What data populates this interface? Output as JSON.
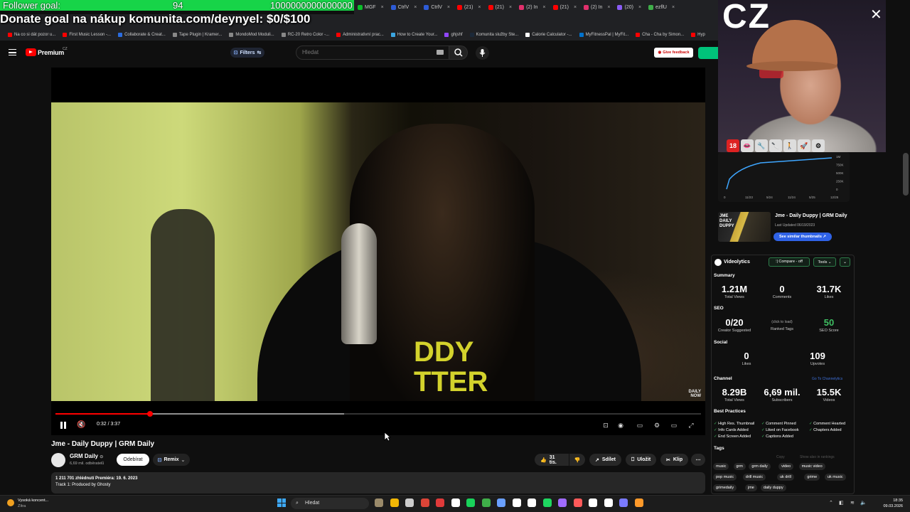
{
  "overlay": {
    "follower_label": "Follower goal:",
    "follower_count": "94",
    "follower_goal": "1000000000000000",
    "donate_text": "Donate goal na nákup komunita.com/deynyel: $0/$100",
    "cz_text": "CZ",
    "emotes": [
      "18",
      "👄",
      "🔧",
      "🔪",
      "🚶",
      "🚀",
      "⚙"
    ]
  },
  "browser": {
    "tabs": [
      {
        "label": "MGF",
        "color": "#0bbd2a"
      },
      {
        "label": "CtrlV",
        "color": "#2d5bd6"
      },
      {
        "label": "CtrlV",
        "color": "#2d5bd6"
      },
      {
        "label": "(21)",
        "color": "#ff0000"
      },
      {
        "label": "(21)",
        "color": "#ff0000"
      },
      {
        "label": "(2) In",
        "color": "#e1306c"
      },
      {
        "label": "(21)",
        "color": "#ff0000"
      },
      {
        "label": "(2) In",
        "color": "#e1306c"
      },
      {
        "label": "(20)",
        "color": "#8a5cf6"
      },
      {
        "label": "ezflU",
        "color": "#3fae49"
      }
    ],
    "bookmarks": [
      {
        "label": "Na co si dát pozor u...",
        "color": "#ff0000"
      },
      {
        "label": "First Music Lesson -...",
        "color": "#ff0000"
      },
      {
        "label": "Collaborate & Creat...",
        "color": "#2b6cdf"
      },
      {
        "label": "Tape Plugin | Kramer...",
        "color": "#888888"
      },
      {
        "label": "MondoMod Moduli...",
        "color": "#888888"
      },
      {
        "label": "RC-20 Retro Color -...",
        "color": "#888888"
      },
      {
        "label": "Administrativní prac...",
        "color": "#ff0000"
      },
      {
        "label": "How to Create Your...",
        "color": "#3ba5e0"
      },
      {
        "label": "ghjshf",
        "color": "#9146ff"
      },
      {
        "label": "Komunita služby Ste...",
        "color": "#1b2838"
      },
      {
        "label": "Calorie Calculator -...",
        "color": "#ffffff"
      },
      {
        "label": "MyFitnessPal | MyFit...",
        "color": "#0072ce"
      },
      {
        "label": "Cha - Cha by Simon...",
        "color": "#ff0000"
      },
      {
        "label": "Hyp",
        "color": "#ff0000"
      }
    ]
  },
  "youtube": {
    "brand": "Premium",
    "region": "CZ",
    "filters_label": "Filters",
    "search_placeholder": "Hledat",
    "feedback_label": "Give feedback"
  },
  "player": {
    "time": "0:32 / 3:37",
    "progress": 0.147,
    "buffered": 0.447,
    "shirt_text": "DDY\nTTER",
    "now_logo": "DAILY\nNOW"
  },
  "video": {
    "title": "Jme - Daily Duppy | GRM Daily",
    "channel": "GRM Daily",
    "channel_check": "⊙",
    "subscribers": "6,69 mil. odběratelů",
    "subscribe_label": "Odebírat",
    "remix_label": "Remix",
    "likes_label": "31 tis.",
    "share_label": "Sdílet",
    "save_label": "Uložit",
    "clip_label": "Klip",
    "views_line": "1 211 701 zhlédnutí  Premiéra: 19. 6. 2023",
    "desc_line": "Track 1: Produced by Ghosty"
  },
  "sidepanel": {
    "graph_ylabels": [
      "1M",
      "750K",
      "500K",
      "250K",
      "0"
    ],
    "graph_xlabels": [
      "0",
      "11/23",
      "5/24",
      "11/24",
      "5/25",
      "12/25"
    ],
    "thumb_title": "Jme - Daily Duppy | GRM Daily",
    "thumb_updated": "Last Updated 06/19/2023",
    "thumb_label": "JME\nDAILY\nDUPPY",
    "similar_label": "See similar thumbnails ↗",
    "vl_title": "Videolytics",
    "compare_label": "⫶| Compare - off",
    "tools_label": "Tools ⌄",
    "dd_label": "⌄",
    "summary_label": "Summary",
    "summary": [
      {
        "value": "1.21M",
        "label": "Total Views"
      },
      {
        "value": "0",
        "label": "Comments"
      },
      {
        "value": "31.7K",
        "label": "Likes"
      }
    ],
    "seo_label": "SEO",
    "seo": [
      {
        "value": "0/20",
        "label": "Creator Suggested"
      },
      {
        "value": "(click to load)",
        "label": "Ranked Tags"
      },
      {
        "value": "50",
        "label": "SEO Score"
      }
    ],
    "social_label": "Social",
    "social": [
      {
        "value": "0",
        "label": "Likes"
      },
      {
        "value": "109",
        "label": "Upvotes"
      }
    ],
    "channel_label": "Channel",
    "go_label": "Go To Channelytics",
    "channel": [
      {
        "value": "8.29B",
        "label": "Total Views"
      },
      {
        "value": "6,69 mil.",
        "label": "Subscribers"
      },
      {
        "value": "15.5K",
        "label": "Videos"
      }
    ],
    "bp_label": "Best Practices",
    "best_practices": [
      [
        "High Res. Thumbnail",
        "Comment Pinned",
        "Comment Hearted"
      ],
      [
        "Info Cards Added",
        "Liked on Facebook",
        "Chapters Added"
      ],
      [
        "End Screen Added",
        "Captions Added",
        ""
      ]
    ],
    "tags_label": "Tags",
    "tags_copy": "Copy",
    "tags_show": "Show also in rankings",
    "tags": [
      "music",
      "grm",
      "grm daily",
      "video",
      "music video",
      "pop music",
      "drill music",
      "uk drill",
      "grime",
      "uk music",
      "grimedaily",
      "jme",
      "daily duppy"
    ]
  },
  "taskbar": {
    "weather_line1": "Vysoká koncent...",
    "weather_line2": "Zítra",
    "search_label": "Hledat",
    "time": "18:35",
    "date": "09.03.2026",
    "apps": [
      "#9a8a6a",
      "#f2b705",
      "#cccccc",
      "#db4437",
      "#e03a3a",
      "#ffffff",
      "#19d25a",
      "#3fae49",
      "#6aa0ff",
      "#ffffff",
      "#ffffff",
      "#1ed760",
      "#a06bff",
      "#ff5a5a",
      "#ffffff",
      "#ffffff",
      "#7a7aff",
      "#ff9a2a"
    ]
  },
  "colors": {
    "accent_red": "#ff0000",
    "follower_green": "#17d448",
    "videolytics_green": "#2e7d4a",
    "blue": "#2f62e6"
  }
}
